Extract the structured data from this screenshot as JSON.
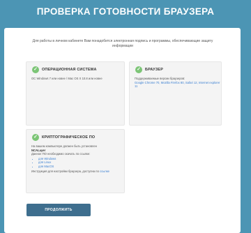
{
  "header": {
    "title": "ПРОВЕРКА ГОТОВНОСТИ БРАУЗЕРА"
  },
  "intro": {
    "text": "Для работы в личном кабинете Вам понадобится электронная подпись и программы, обеспечивающие защиту информации"
  },
  "cards": {
    "os": {
      "title": "ОПЕРАЦИОННАЯ СИСТЕМА",
      "text": "ОС Windows 7 или новее / Mac OS X 10.8 или новее"
    },
    "browser": {
      "title": "БРАУЗЕР",
      "text": "Поддерживаемые версии браузеров:",
      "browsers": "Google Chrome 70, Mozilla Firefox 80, Safari 12, Internet explorer 11"
    },
    "crypto": {
      "title": "КРИПТОГРАФИЧЕСКОЕ ПО",
      "line1": "На вашем компьютере должен быть установлен",
      "product": "NCALayer",
      "line2": "Данное ПО необходимо скачать по ссылке:",
      "links": [
        "для Windows",
        "для Linux",
        "для MacOS"
      ],
      "footer": "Инструкция для настройки браузера, доступна по",
      "footer_link": "ссылке"
    }
  },
  "button": {
    "label": "ПРОДОЛЖИТЬ"
  },
  "colors": {
    "header_bg": "#4c95b4",
    "check": "#7cc576",
    "button": "#3e6e8e",
    "link": "#3a7fd1"
  },
  "icons": {
    "check": "check-circle-icon"
  }
}
